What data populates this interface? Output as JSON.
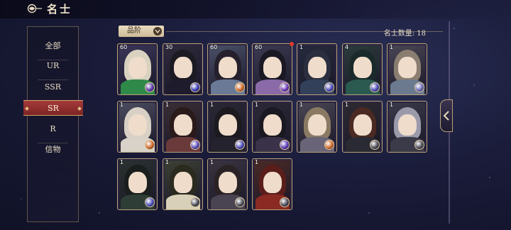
{
  "header": {
    "title": "名士"
  },
  "sidebar": {
    "items": [
      {
        "label": "全部",
        "active": false
      },
      {
        "label": "UR",
        "active": false
      },
      {
        "label": "SSR",
        "active": false
      },
      {
        "label": "SR",
        "active": true
      },
      {
        "label": "R",
        "active": false
      },
      {
        "label": "信物",
        "active": false
      }
    ]
  },
  "main": {
    "sort_label": "品阶",
    "count_label": "名士数量: 18"
  },
  "cards": [
    {
      "level": "60",
      "hair": "#d9d2c0",
      "robe": "#2f8a4a",
      "orb": "#5a3aa8",
      "art": "#3a3558"
    },
    {
      "level": "30",
      "hair": "#1c1a22",
      "robe": "#1e1c2c",
      "orb": "#3a3ab8",
      "art": "#2e2a3c"
    },
    {
      "level": "60",
      "hair": "#25202c",
      "robe": "#6a7a96",
      "orb": "#d06a2a",
      "art": "#4a5068"
    },
    {
      "level": "60",
      "hair": "#1a1822",
      "robe": "#8a6aa8",
      "orb": "#6a3ab8",
      "art": "#3c3a52"
    },
    {
      "level": "1",
      "hair": "#2a2e3e",
      "robe": "#33405a",
      "orb": "#4a4ab8",
      "art": "#262a3e"
    },
    {
      "level": "4",
      "hair": "#1a2a2a",
      "robe": "#2a5a50",
      "orb": "#4a4ab8",
      "art": "#2b3b3c"
    },
    {
      "level": "1",
      "hair": "#8a7e70",
      "robe": "#6c7a90",
      "orb": "#6a6ab8",
      "art": "#4a4656"
    },
    {
      "level": "1",
      "hair": "#d8d0c4",
      "robe": "#d8d2c8",
      "orb": "#d06a2a",
      "art": "#4c4c60"
    },
    {
      "level": "1",
      "hair": "#2a1a1a",
      "robe": "#6a3a3a",
      "orb": "#5a4ab8",
      "art": "#3a2e34"
    },
    {
      "level": "1",
      "hair": "#1c1a1e",
      "robe": "#24222c",
      "orb": "#4a4ab8",
      "art": "#2a2834"
    },
    {
      "level": "1",
      "hair": "#1a1820",
      "robe": "#3a3248",
      "orb": "#5a3ab8",
      "art": "#2c2838"
    },
    {
      "level": "1",
      "hair": "#8a7a64",
      "robe": "#6a6478",
      "orb": "#d06a2a",
      "art": "#4a4654"
    },
    {
      "level": "1",
      "hair": "#4a2a22",
      "robe": "#2a2a34",
      "orb": "#4a4a58",
      "art": "#2e2a32"
    },
    {
      "level": "1",
      "hair": "#9a9aaa",
      "robe": "#3a3a48",
      "orb": "#4a4a58",
      "art": "#3a3a4a"
    },
    {
      "level": "1",
      "hair": "#1a1e1c",
      "robe": "#2e3e36",
      "orb": "#4a4ab8",
      "art": "#2a3230"
    },
    {
      "level": "1",
      "hair": "#2a2a1e",
      "robe": "#d8d0b8",
      "orb": "#4a4a58",
      "art": "#3c4034"
    },
    {
      "level": "1",
      "hair": "#2a2224",
      "robe": "#4a4452",
      "orb": "#4a4a58",
      "art": "#3a3440"
    },
    {
      "level": "1",
      "hair": "#5a1e1a",
      "robe": "#8a2a22",
      "orb": "#4a4a58",
      "art": "#4a2a26"
    }
  ]
}
